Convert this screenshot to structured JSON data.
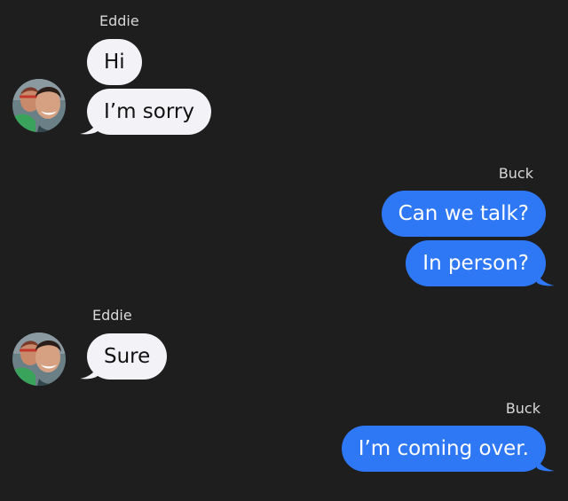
{
  "conversation": {
    "colors": {
      "background": "#1e1e1e",
      "incoming_bubble": "#f2f2f7",
      "outgoing_bubble": "#2f78f5"
    },
    "groups": [
      {
        "sender": "Eddie",
        "direction": "incoming",
        "avatar_icon": "contact-photo-icon",
        "messages": [
          "Hi",
          "I’m sorry"
        ]
      },
      {
        "sender": "Buck",
        "direction": "outgoing",
        "messages": [
          "Can we talk?",
          "In person?"
        ]
      },
      {
        "sender": "Eddie",
        "direction": "incoming",
        "avatar_icon": "contact-photo-icon",
        "messages": [
          "Sure"
        ]
      },
      {
        "sender": "Buck",
        "direction": "outgoing",
        "messages": [
          "I’m coming over."
        ]
      }
    ]
  }
}
